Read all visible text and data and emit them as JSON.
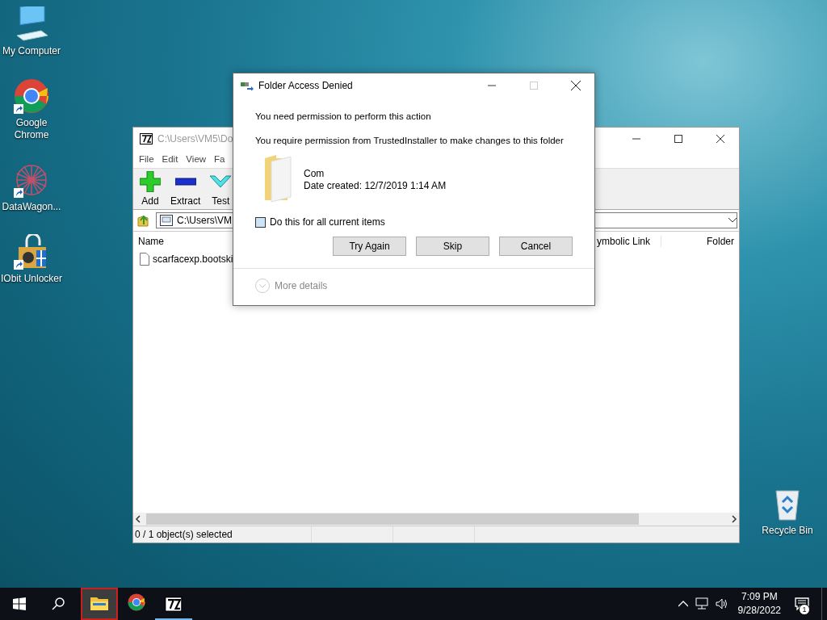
{
  "desktop_icons": [
    {
      "label": "My Computer",
      "kind": "computer",
      "shortcut": false
    },
    {
      "label": "Google Chrome",
      "kind": "chrome",
      "shortcut": true
    },
    {
      "label": "DataWagon...",
      "kind": "datawagon",
      "shortcut": true
    },
    {
      "label": "IObit Unlocker",
      "kind": "iobit",
      "shortcut": true
    }
  ],
  "recycle_bin": {
    "label": "Recycle Bin"
  },
  "archive_window": {
    "title": "C:\\Users\\VM5\\Do",
    "menu": [
      "File",
      "Edit",
      "View",
      "Fa"
    ],
    "toolbar": [
      {
        "label": "Add",
        "kind": "add"
      },
      {
        "label": "Extract",
        "kind": "extract"
      },
      {
        "label": "Test",
        "kind": "test"
      }
    ],
    "address": "C:\\Users\\VM",
    "columns": [
      "Name",
      "ymbolic Link",
      "Folder"
    ],
    "rows": [
      {
        "name": "scarfacexp.bootski"
      }
    ],
    "status": "0 / 1 object(s) selected"
  },
  "dialog": {
    "title": "Folder Access Denied",
    "heading": "You need permission to perform this action",
    "message": "You require permission from TrustedInstaller to make changes to this folder",
    "item": {
      "name": "Com",
      "date": "Date created: 12/7/2019 1:14 AM"
    },
    "checkbox": {
      "label": "Do this for all current items",
      "checked": false
    },
    "buttons": [
      "Try Again",
      "Skip",
      "Cancel"
    ],
    "more_details": "More details"
  },
  "taskbar": {
    "apps": [
      {
        "kind": "explorer",
        "selected": true,
        "running": false
      },
      {
        "kind": "chrome",
        "selected": false,
        "running": false
      },
      {
        "kind": "sevenzip",
        "selected": false,
        "running": true
      }
    ],
    "time": "7:09 PM",
    "date": "9/28/2022",
    "notifications": "1"
  }
}
